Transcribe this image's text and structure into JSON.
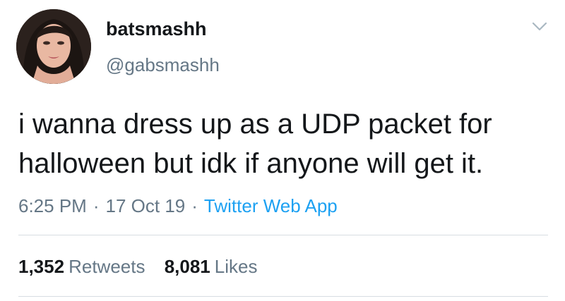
{
  "user": {
    "display_name": "batsmashh",
    "handle": "@gabsmashh"
  },
  "tweet": {
    "lines": [
      "i wanna dress up as a UDP packet for",
      "halloween but idk if anyone will get it."
    ],
    "time": "6:25 PM",
    "separator": "·",
    "date": "17 Oct 19",
    "source": "Twitter Web App"
  },
  "stats": {
    "retweets_count": "1,352",
    "retweets_label": "Retweets",
    "likes_count": "8,081",
    "likes_label": "Likes"
  },
  "colors": {
    "text": "#14171a",
    "secondary": "#657786",
    "link": "#1da1f2",
    "divider": "#d7dde2"
  },
  "icons": {
    "menu": "chevron-down-icon"
  }
}
